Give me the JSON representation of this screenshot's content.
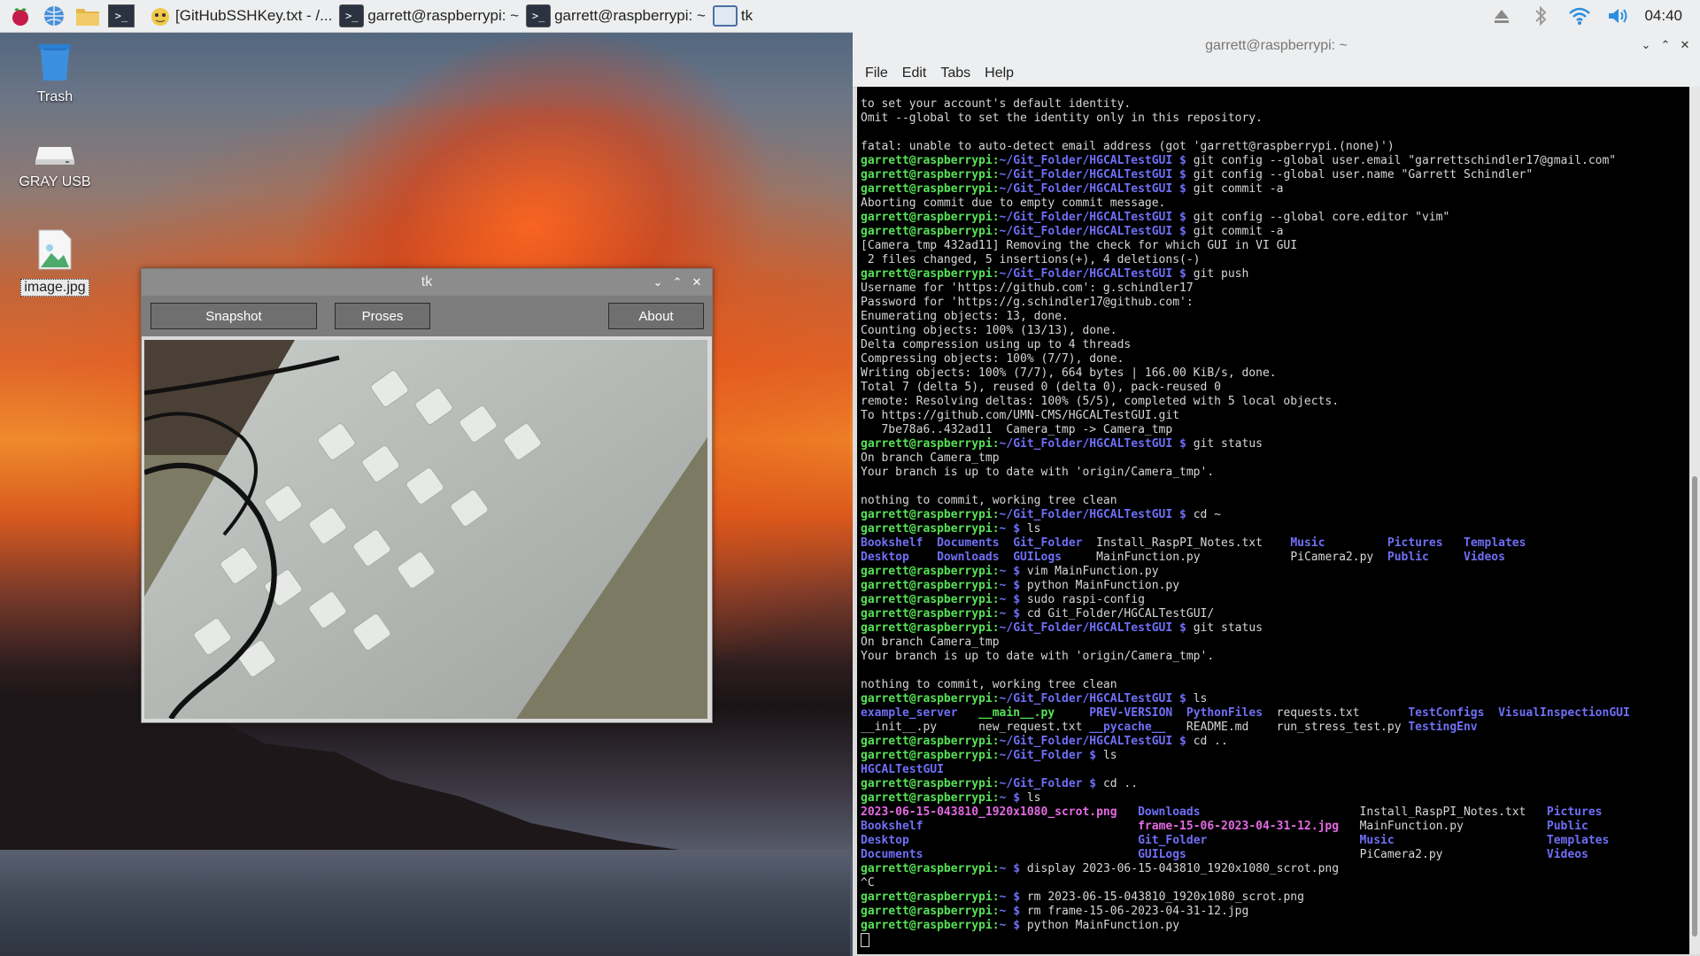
{
  "taskbar": {
    "apps": [
      {
        "icon": "raspberry-menu-icon"
      },
      {
        "icon": "web-browser-icon"
      },
      {
        "icon": "file-manager-icon"
      },
      {
        "icon": "terminal-launcher-icon"
      }
    ],
    "tasks": [
      {
        "label": "[GitHubSSHKey.txt - /...",
        "icon": "text-editor-icon"
      },
      {
        "label": "garrett@raspberrypi: ~",
        "icon": "terminal-icon"
      },
      {
        "label": "garrett@raspberrypi: ~",
        "icon": "terminal-icon"
      },
      {
        "label": "tk",
        "icon": "window-icon"
      }
    ],
    "tray": {
      "eject": "eject-icon",
      "bluetooth": "bluetooth-icon",
      "wifi": "wifi-icon",
      "volume": "volume-icon"
    },
    "clock": "04:40"
  },
  "desktop": {
    "icons": [
      {
        "label": "Trash",
        "icon": "trash-icon"
      },
      {
        "label": "GRAY USB",
        "icon": "usb-drive-icon"
      },
      {
        "label": "image.jpg",
        "icon": "image-file-icon"
      }
    ]
  },
  "tk_window": {
    "title": "tk",
    "buttons": {
      "snapshot": "Snapshot",
      "proses": "Proses",
      "about": "About"
    }
  },
  "terminal": {
    "title": "garrett@raspberrypi: ~",
    "menu": [
      "File",
      "Edit",
      "Tabs",
      "Help"
    ],
    "lines": [
      {
        "t": "to set your account's default identity."
      },
      {
        "t": "Omit --global to set the identity only in this repository."
      },
      {
        "t": ""
      },
      {
        "t": "fatal: unable to auto-detect email address (got 'garrett@raspberrypi.(none)')"
      },
      {
        "p": "garrett@raspberrypi",
        "d": "~/Git_Folder/HGCALTestGUI",
        "c": "git config --global user.email \"garrettschindler17@gmail.com\""
      },
      {
        "p": "garrett@raspberrypi",
        "d": "~/Git_Folder/HGCALTestGUI",
        "c": "git config --global user.name \"Garrett Schindler\""
      },
      {
        "p": "garrett@raspberrypi",
        "d": "~/Git_Folder/HGCALTestGUI",
        "c": "git commit -a"
      },
      {
        "t": "Aborting commit due to empty commit message."
      },
      {
        "p": "garrett@raspberrypi",
        "d": "~/Git_Folder/HGCALTestGUI",
        "c": "git config --global core.editor \"vim\""
      },
      {
        "p": "garrett@raspberrypi",
        "d": "~/Git_Folder/HGCALTestGUI",
        "c": "git commit -a"
      },
      {
        "t": "[Camera_tmp 432ad11] Removing the check for which GUI in VI GUI"
      },
      {
        "t": " 2 files changed, 5 insertions(+), 4 deletions(-)"
      },
      {
        "p": "garrett@raspberrypi",
        "d": "~/Git_Folder/HGCALTestGUI",
        "c": "git push"
      },
      {
        "t": "Username for 'https://github.com': g.schindler17"
      },
      {
        "t": "Password for 'https://g.schindler17@github.com':"
      },
      {
        "t": "Enumerating objects: 13, done."
      },
      {
        "t": "Counting objects: 100% (13/13), done."
      },
      {
        "t": "Delta compression using up to 4 threads"
      },
      {
        "t": "Compressing objects: 100% (7/7), done."
      },
      {
        "t": "Writing objects: 100% (7/7), 664 bytes | 166.00 KiB/s, done."
      },
      {
        "t": "Total 7 (delta 5), reused 0 (delta 0), pack-reused 0"
      },
      {
        "t": "remote: Resolving deltas: 100% (5/5), completed with 5 local objects."
      },
      {
        "t": "To https://github.com/UMN-CMS/HGCALTestGUI.git"
      },
      {
        "t": "   7be78a6..432ad11  Camera_tmp -> Camera_tmp"
      },
      {
        "p": "garrett@raspberrypi",
        "d": "~/Git_Folder/HGCALTestGUI",
        "c": "git status"
      },
      {
        "t": "On branch Camera_tmp"
      },
      {
        "t": "Your branch is up to date with 'origin/Camera_tmp'."
      },
      {
        "t": ""
      },
      {
        "t": "nothing to commit, working tree clean"
      },
      {
        "p": "garrett@raspberrypi",
        "d": "~/Git_Folder/HGCALTestGUI",
        "c": "cd ~"
      },
      {
        "p": "garrett@raspberrypi",
        "d": "~",
        "c": "ls"
      },
      {
        "cols": [
          {
            "v": "Bookshelf",
            "k": "dir"
          },
          {
            "v": "Documents",
            "k": "dir"
          },
          {
            "v": "Git_Folder",
            "k": "dir"
          },
          {
            "v": "Install_RaspPI_Notes.txt",
            "k": ""
          },
          {
            "v": "Music",
            "k": "dir"
          },
          {
            "v": "Pictures",
            "k": "dir"
          },
          {
            "v": "Templates",
            "k": "dir"
          }
        ],
        "w": [
          9,
          9,
          10,
          26,
          12,
          9,
          9
        ]
      },
      {
        "cols": [
          {
            "v": "Desktop",
            "k": "dir"
          },
          {
            "v": "Downloads",
            "k": "dir"
          },
          {
            "v": "GUILogs",
            "k": "dir"
          },
          {
            "v": "MainFunction.py",
            "k": ""
          },
          {
            "v": "PiCamera2.py",
            "k": ""
          },
          {
            "v": "Public",
            "k": "dir"
          },
          {
            "v": "Videos",
            "k": "dir"
          }
        ],
        "w": [
          9,
          9,
          10,
          26,
          12,
          9,
          9
        ]
      },
      {
        "p": "garrett@raspberrypi",
        "d": "~",
        "c": "vim MainFunction.py"
      },
      {
        "p": "garrett@raspberrypi",
        "d": "~",
        "c": "python MainFunction.py"
      },
      {
        "p": "garrett@raspberrypi",
        "d": "~",
        "c": "sudo raspi-config"
      },
      {
        "p": "garrett@raspberrypi",
        "d": "~",
        "c": "cd Git_Folder/HGCALTestGUI/"
      },
      {
        "p": "garrett@raspberrypi",
        "d": "~/Git_Folder/HGCALTestGUI",
        "c": "git status"
      },
      {
        "t": "On branch Camera_tmp"
      },
      {
        "t": "Your branch is up to date with 'origin/Camera_tmp'."
      },
      {
        "t": ""
      },
      {
        "t": "nothing to commit, working tree clean"
      },
      {
        "p": "garrett@raspberrypi",
        "d": "~/Git_Folder/HGCALTestGUI",
        "c": "ls"
      },
      {
        "cols": [
          {
            "v": "example_server",
            "k": "dir"
          },
          {
            "v": "__main__.py",
            "k": "pg"
          },
          {
            "v": "PREV-VERSION",
            "k": "dir"
          },
          {
            "v": "PythonFiles",
            "k": "dir"
          },
          {
            "v": "requests.txt",
            "k": ""
          },
          {
            "v": "TestConfigs",
            "k": "dir"
          },
          {
            "v": "VisualInspectionGUI",
            "k": "dir"
          }
        ],
        "w": [
          15,
          14,
          12,
          11,
          17,
          11,
          19
        ]
      },
      {
        "cols": [
          {
            "v": "__init__.py",
            "k": ""
          },
          {
            "v": "new_request.txt",
            "k": ""
          },
          {
            "v": "__pycache__",
            "k": "dir"
          },
          {
            "v": "README.md",
            "k": ""
          },
          {
            "v": "run_stress_test.py",
            "k": ""
          },
          {
            "v": "TestingEnv",
            "k": "dir"
          }
        ],
        "w": [
          15,
          14,
          12,
          11,
          17,
          11
        ]
      },
      {
        "p": "garrett@raspberrypi",
        "d": "~/Git_Folder/HGCALTestGUI",
        "c": "cd .."
      },
      {
        "p": "garrett@raspberrypi",
        "d": "~/Git_Folder",
        "c": "ls"
      },
      {
        "cols": [
          {
            "v": "HGCALTestGUI",
            "k": "dir"
          }
        ],
        "w": [
          12
        ]
      },
      {
        "p": "garrett@raspberrypi",
        "d": "~/Git_Folder",
        "c": "cd .."
      },
      {
        "p": "garrett@raspberrypi",
        "d": "~",
        "c": "ls"
      },
      {
        "cols": [
          {
            "v": "2023-06-15-043810_1920x1080_scrot.png",
            "k": "img"
          },
          {
            "v": "Downloads",
            "k": "dir"
          },
          {
            "v": "Install_RaspPI_Notes.txt",
            "k": ""
          },
          {
            "v": "Pictures",
            "k": "dir"
          }
        ],
        "w": [
          38,
          30,
          25,
          9
        ]
      },
      {
        "cols": [
          {
            "v": "Bookshelf",
            "k": "dir"
          },
          {
            "v": "frame-15-06-2023-04-31-12.jpg",
            "k": "img"
          },
          {
            "v": "MainFunction.py",
            "k": ""
          },
          {
            "v": "Public",
            "k": "dir"
          }
        ],
        "w": [
          38,
          30,
          25,
          9
        ]
      },
      {
        "cols": [
          {
            "v": "Desktop",
            "k": "dir"
          },
          {
            "v": "Git_Folder",
            "k": "dir"
          },
          {
            "v": "Music",
            "k": "dir"
          },
          {
            "v": "Templates",
            "k": "dir"
          }
        ],
        "w": [
          38,
          30,
          25,
          9
        ]
      },
      {
        "cols": [
          {
            "v": "Documents",
            "k": "dir"
          },
          {
            "v": "GUILogs",
            "k": "dir"
          },
          {
            "v": "PiCamera2.py",
            "k": ""
          },
          {
            "v": "Videos",
            "k": "dir"
          }
        ],
        "w": [
          38,
          30,
          25,
          9
        ]
      },
      {
        "p": "garrett@raspberrypi",
        "d": "~",
        "c": "display 2023-06-15-043810_1920x1080_scrot.png"
      },
      {
        "t": "^C"
      },
      {
        "p": "garrett@raspberrypi",
        "d": "~",
        "c": "rm 2023-06-15-043810_1920x1080_scrot.png"
      },
      {
        "p": "garrett@raspberrypi",
        "d": "~",
        "c": "rm frame-15-06-2023-04-31-12.jpg"
      },
      {
        "p": "garrett@raspberrypi",
        "d": "~",
        "c": "python MainFunction.py"
      },
      {
        "cursor": true
      }
    ]
  }
}
